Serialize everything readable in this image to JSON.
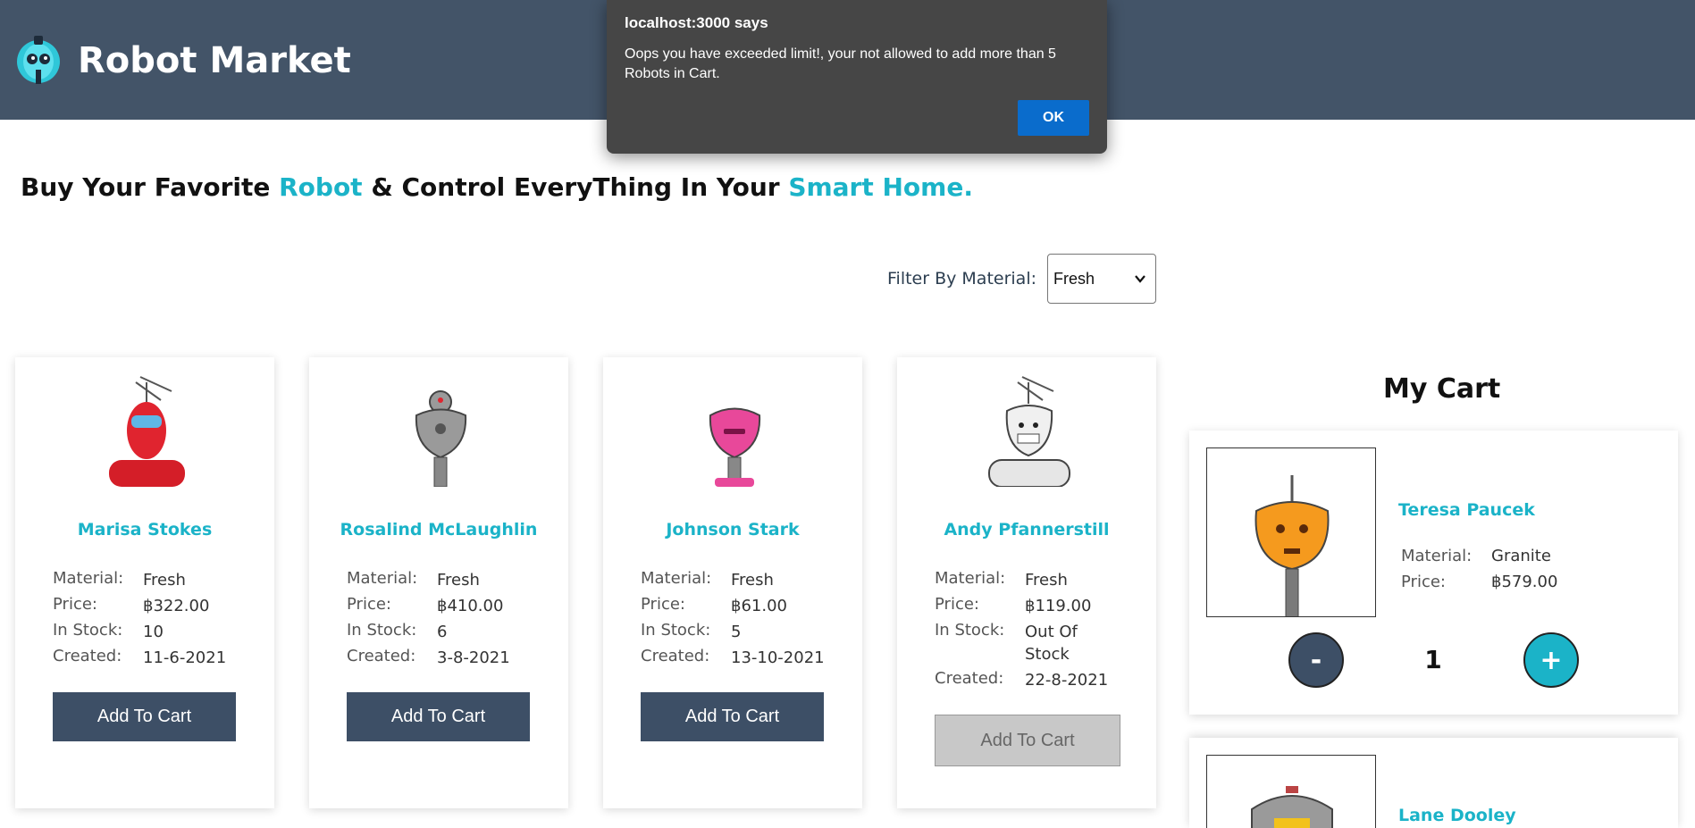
{
  "header": {
    "brand": "Robot Market",
    "background": "#435468"
  },
  "headline": {
    "part1": "Buy Your Favorite ",
    "accent1": "Robot",
    "part2": " & Control EveryThing In Your ",
    "accent2": "Smart Home.",
    "accent_color": "#1bb3c8"
  },
  "filter": {
    "label": "Filter By Material:",
    "selected": "Fresh"
  },
  "labels": {
    "material": "Material:",
    "price": "Price:",
    "stock": "In Stock:",
    "created": "Created:"
  },
  "products": [
    {
      "name": "Marisa Stokes",
      "material": "Fresh",
      "price": "฿322.00",
      "stock": "10",
      "created": "11-6-2021",
      "button": "Add To Cart",
      "color": "#e0242f",
      "icon": "red-robot-icon"
    },
    {
      "name": "Rosalind McLaughlin",
      "material": "Fresh",
      "price": "฿410.00",
      "stock": "6",
      "created": "3-8-2021",
      "button": "Add To Cart",
      "color": "#9a9a9a",
      "icon": "gray-robot-icon"
    },
    {
      "name": "Johnson Stark",
      "material": "Fresh",
      "price": "฿61.00",
      "stock": "5",
      "created": "13-10-2021",
      "button": "Add To Cart",
      "color": "#e8489a",
      "icon": "pink-robot-icon"
    },
    {
      "name": "Andy Pfannerstill",
      "material": "Fresh",
      "price": "฿119.00",
      "stock": "Out Of Stock",
      "created": "22-8-2021",
      "button": "Add To Cart",
      "color": "#e6e6e6",
      "icon": "white-robot-icon"
    }
  ],
  "cart": {
    "title": "My Cart",
    "items": [
      {
        "name": "Teresa Paucek",
        "material": "Granite",
        "price": "฿579.00",
        "qty": "1",
        "minus": "-",
        "plus": "+"
      },
      {
        "name": "Lane Dooley"
      }
    ]
  },
  "dialog": {
    "title": "localhost:3000 says",
    "message": "Oops you have exceeded limit!, your not allowed to add more than 5 Robots in Cart.",
    "ok": "OK"
  }
}
